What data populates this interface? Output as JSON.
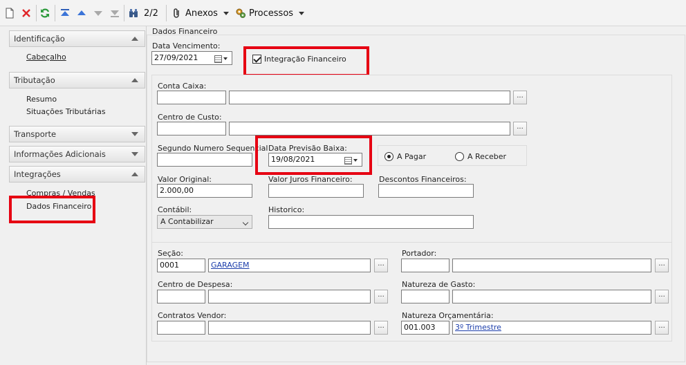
{
  "toolbar": {
    "icons": [
      "new-document-icon",
      "delete-icon",
      "refresh-icon",
      "first-record-icon",
      "previous-record-icon",
      "next-record-icon",
      "last-record-icon",
      "binoculars-icon"
    ],
    "record_counter": "2/2",
    "anexos_label": "Anexos",
    "processos_label": "Processos"
  },
  "nav": {
    "identificacao": "Identificação",
    "cabecalho": "Cabeçalho",
    "tributacao": "Tributação",
    "resumo": "Resumo",
    "situacoes": "Situações Tributárias",
    "transporte": "Transporte",
    "informacoes": "Informações Adicionais",
    "integracoes": "Integrações",
    "compras": "Compras / Vendas",
    "dados_financeiro": "Dados Financeiro"
  },
  "form": {
    "section_title": "Dados Financeiro",
    "data_vencimento_label": "Data Vencimento:",
    "data_vencimento_value": "27/09/2021",
    "integracao_label": "Integração Financeiro",
    "conta_caixa_label": "Conta Caixa:",
    "centro_custo_label": "Centro de Custo:",
    "segundo_numero_label": "Segundo Numero Sequencial",
    "data_previsao_label": "Data Previsão Baixa:",
    "data_previsao_value": "19/08/2021",
    "a_pagar_label": "A Pagar",
    "a_receber_label": "A Receber",
    "valor_original_label": "Valor Original:",
    "valor_original_value": "2.000,00",
    "valor_juros_label": "Valor Juros Financeiro:",
    "descontos_label": "Descontos Financeiros:",
    "contabil_label": "Contábil:",
    "contabil_value": "A Contabilizar",
    "historico_label": "Historico:",
    "secao_label": "Seção:",
    "secao_code": "0001",
    "secao_name": "GARAGEM",
    "portador_label": "Portador:",
    "centro_despesa_label": "Centro de Despesa:",
    "natureza_gasto_label": "Natureza de Gasto:",
    "contratos_label": "Contratos Vendor:",
    "natureza_orc_label": "Natureza Orçamentária:",
    "natureza_orc_code": "001.003",
    "natureza_orc_name": "3º Trimestre",
    "ellipsis": "..."
  },
  "colors": {
    "highlight": "#e60012",
    "link": "#1a3caa"
  }
}
